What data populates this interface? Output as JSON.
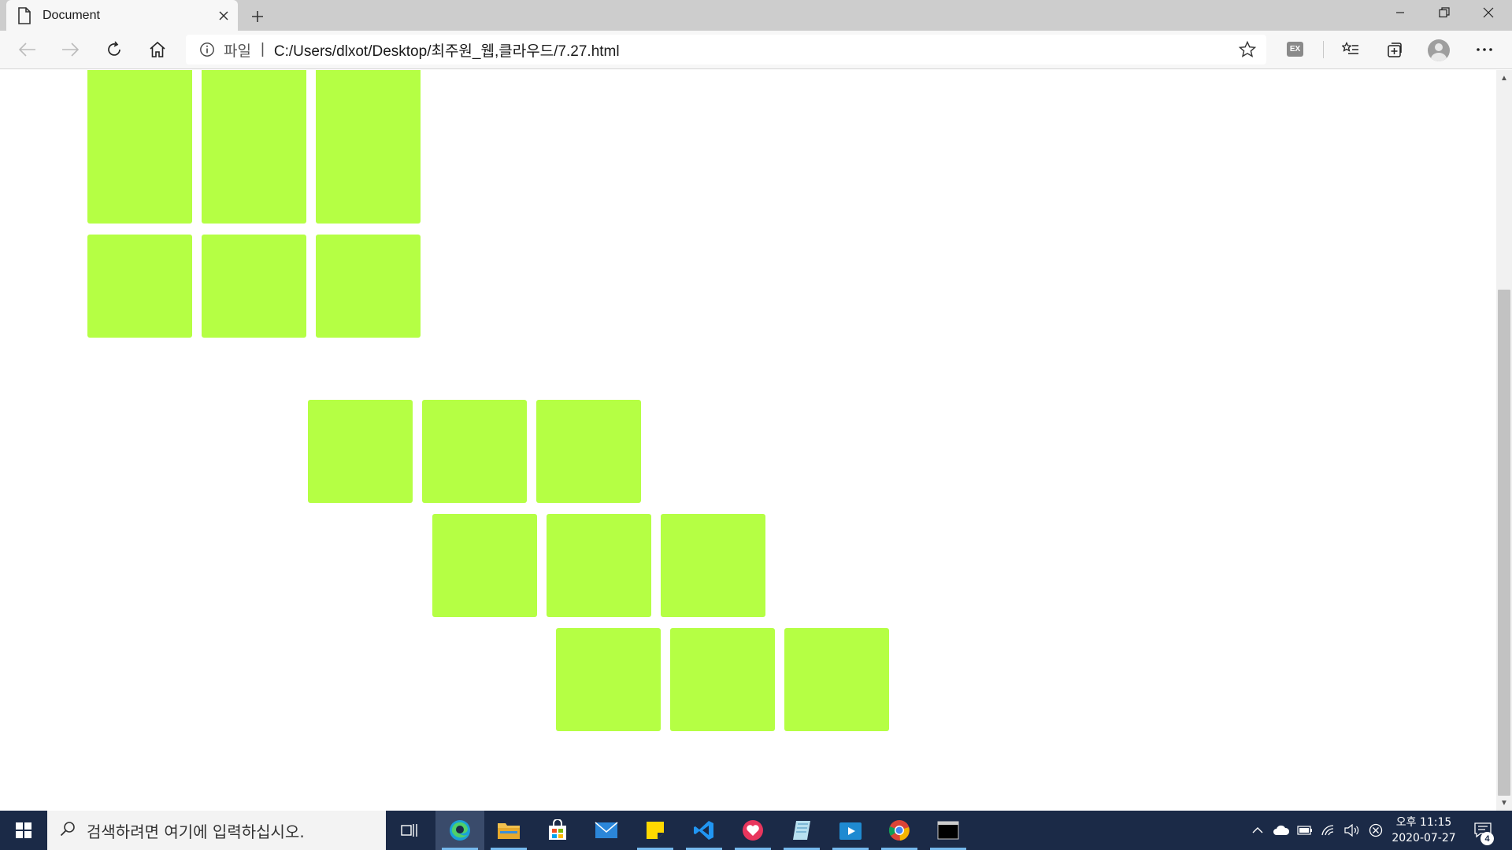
{
  "browser": {
    "tab": {
      "title": "Document"
    },
    "new_tab": "+",
    "address": {
      "scheme_label": "파일",
      "separator": "|",
      "url": "C:/Users/dlxot/Desktop/최주원_웹,클라우드/7.27.html"
    },
    "extension_label": "EX"
  },
  "page": {
    "box_color": "#b5ff44",
    "groups": [
      {
        "name": "top-grid",
        "rows": 3,
        "cols": 3,
        "count": 9
      },
      {
        "name": "staggered-grid",
        "rows": 3,
        "cols": 3,
        "count": 9
      }
    ]
  },
  "taskbar": {
    "search_placeholder": "검색하려면 여기에 입력하십시오.",
    "apps": [
      "task-view",
      "edge",
      "file-explorer",
      "microsoft-store",
      "mail",
      "sticky-notes",
      "vscode",
      "kakao-heart",
      "notes",
      "media-player",
      "chrome",
      "terminal"
    ],
    "clock": {
      "period_time": "오후 11:15",
      "date": "2020-07-27"
    },
    "notification_count": "4"
  }
}
